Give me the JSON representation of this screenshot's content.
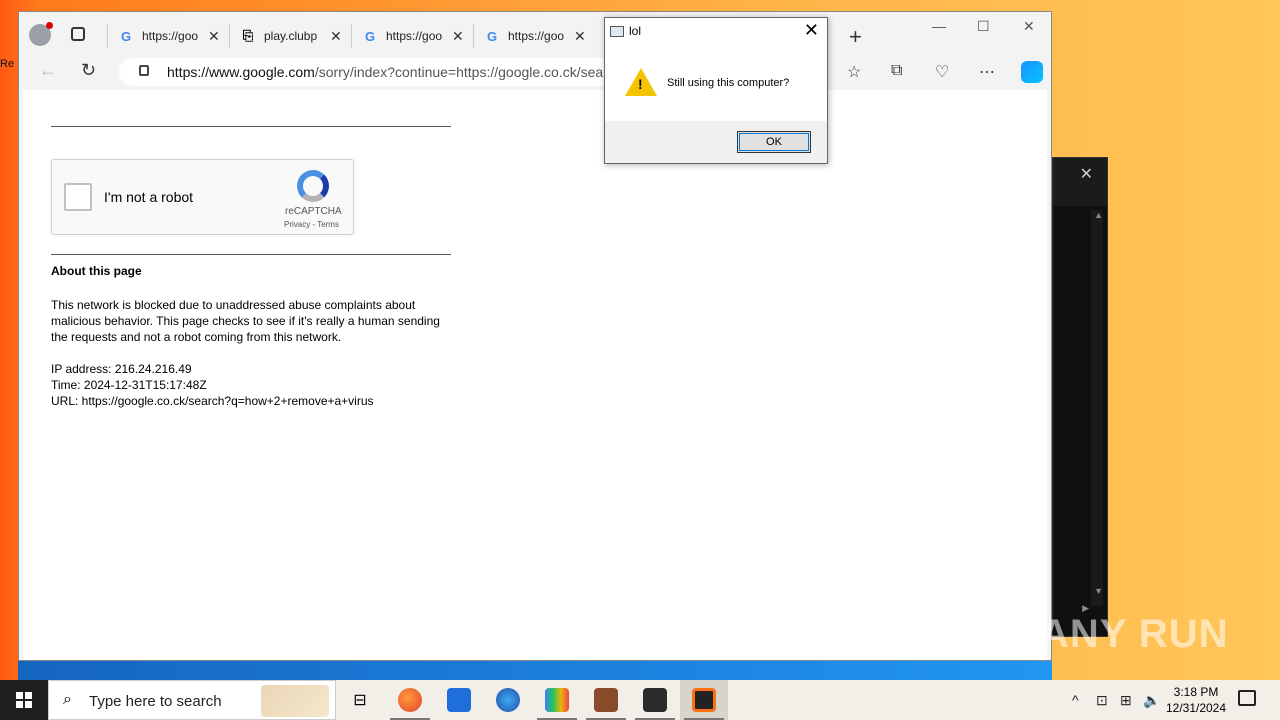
{
  "dialog": {
    "title": "lol",
    "message": "Still using this computer?",
    "ok_label": "OK"
  },
  "browser": {
    "tabs": [
      {
        "title": "https://goo",
        "favicon": "google-icon"
      },
      {
        "title": "play.clubp",
        "favicon": "page-icon"
      },
      {
        "title": "https://goo",
        "favicon": "google-icon"
      },
      {
        "title": "https://goo",
        "favicon": "google-icon"
      }
    ],
    "url_host": "https://www.google.com",
    "url_path": "/sorry/index?continue=https://google.co.ck/sear"
  },
  "page": {
    "captcha_label": "I'm not a robot",
    "captcha_brand": "reCAPTCHA",
    "captcha_terms": "Privacy - Terms",
    "about_title": "About this page",
    "about_text": "This network is blocked due to unaddressed abuse complaints about malicious behavior. This page checks to see if it's really a human sending the requests and not a robot coming from this network.",
    "ip_line": "IP address: 216.24.216.49",
    "time_line": "Time: 2024-12-31T15:17:48Z",
    "url_line": "URL: https://google.co.ck/search?q=how+2+remove+a+virus"
  },
  "taskbar": {
    "search_placeholder": "Type here to search",
    "time": "3:18 PM",
    "date": "12/31/2024"
  },
  "watermark": "ANY RUN",
  "colors": {
    "taskbar_bg": "#f2efe9",
    "accent_blue": "#1565c0",
    "warning_yellow": "#f5c400"
  }
}
